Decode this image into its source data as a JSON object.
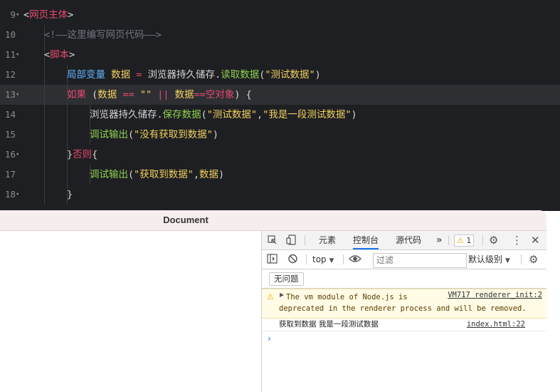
{
  "editor": {
    "lines": [
      {
        "num": "9",
        "fold": true,
        "tokens": [
          {
            "c": "br",
            "t": "<"
          },
          {
            "c": "tag",
            "t": "网页主体"
          },
          {
            "c": "br",
            "t": ">"
          }
        ]
      },
      {
        "num": "10",
        "fold": false,
        "indent": 1,
        "tokens": [
          {
            "c": "cm",
            "t": "<!——这里编写网页代码——>"
          }
        ]
      },
      {
        "num": "11",
        "fold": true,
        "indent": 1,
        "tokens": [
          {
            "c": "br",
            "t": "<"
          },
          {
            "c": "tag",
            "t": "脚本"
          },
          {
            "c": "br",
            "t": ">"
          }
        ]
      },
      {
        "num": "12",
        "fold": false,
        "indent": 2,
        "tokens": [
          {
            "c": "bl",
            "t": "局部变量"
          },
          {
            "c": "pl",
            "t": " "
          },
          {
            "c": "var",
            "t": "数据"
          },
          {
            "c": "pl",
            "t": " "
          },
          {
            "c": "op",
            "t": "="
          },
          {
            "c": "pl",
            "t": " "
          },
          {
            "c": "obj",
            "t": "浏览器持久储存"
          },
          {
            "c": "pl",
            "t": "."
          },
          {
            "c": "mth",
            "t": "读取数据"
          },
          {
            "c": "pl",
            "t": "("
          },
          {
            "c": "str",
            "t": "\"测试数据\""
          },
          {
            "c": "pl",
            "t": ")"
          }
        ]
      },
      {
        "num": "13",
        "fold": true,
        "indent": 2,
        "active": true,
        "tokens": [
          {
            "c": "kw",
            "t": "如果"
          },
          {
            "c": "pl",
            "t": " ("
          },
          {
            "c": "var",
            "t": "数据"
          },
          {
            "c": "pl",
            "t": " "
          },
          {
            "c": "op",
            "t": "=="
          },
          {
            "c": "pl",
            "t": " "
          },
          {
            "c": "str",
            "t": "\"\""
          },
          {
            "c": "pl",
            "t": " "
          },
          {
            "c": "op",
            "t": "||"
          },
          {
            "c": "pl",
            "t": " "
          },
          {
            "c": "var",
            "t": "数据"
          },
          {
            "c": "op",
            "t": "=="
          },
          {
            "c": "kw",
            "t": "空对象"
          },
          {
            "c": "pl",
            "t": ") {"
          }
        ]
      },
      {
        "num": "14",
        "fold": false,
        "indent": 3,
        "tokens": [
          {
            "c": "obj",
            "t": "浏览器持久储存"
          },
          {
            "c": "pl",
            "t": "."
          },
          {
            "c": "mth",
            "t": "保存数据"
          },
          {
            "c": "pl",
            "t": "("
          },
          {
            "c": "str",
            "t": "\"测试数据\""
          },
          {
            "c": "pl",
            "t": ","
          },
          {
            "c": "str",
            "t": "\"我是一段测试数据\""
          },
          {
            "c": "pl",
            "t": ")"
          }
        ]
      },
      {
        "num": "15",
        "fold": false,
        "indent": 3,
        "tokens": [
          {
            "c": "fn",
            "t": "调试输出"
          },
          {
            "c": "pl",
            "t": "("
          },
          {
            "c": "str",
            "t": "\"没有获取到数据\""
          },
          {
            "c": "pl",
            "t": ")"
          }
        ]
      },
      {
        "num": "16",
        "fold": true,
        "indent": 2,
        "tokens": [
          {
            "c": "pl",
            "t": "}"
          },
          {
            "c": "kw",
            "t": "否则"
          },
          {
            "c": "pl",
            "t": "{"
          }
        ]
      },
      {
        "num": "17",
        "fold": false,
        "indent": 3,
        "tokens": [
          {
            "c": "fn",
            "t": "调试输出"
          },
          {
            "c": "pl",
            "t": "("
          },
          {
            "c": "str",
            "t": "\"获取到数据\""
          },
          {
            "c": "pl",
            "t": ","
          },
          {
            "c": "var",
            "t": "数据"
          },
          {
            "c": "pl",
            "t": ")"
          }
        ]
      },
      {
        "num": "18",
        "fold": true,
        "indent": 2,
        "tokens": [
          {
            "c": "pl",
            "t": "}"
          }
        ]
      }
    ]
  },
  "window": {
    "title": "Document"
  },
  "devtools": {
    "tabs": {
      "elements": "元素",
      "console": "控制台",
      "sources": "源代码",
      "more": "»"
    },
    "warning_badge": "1",
    "toolbar": {
      "context": "top",
      "filter_placeholder": "过滤",
      "levels": "默认级别"
    },
    "issues_button": "无问题",
    "messages": {
      "warning_text": "The vm module of Node.js is deprecated in the renderer process and will be removed.",
      "warning_source": "VM717 renderer_init:2",
      "log_text": "获取到数据 我是一段测试数据",
      "log_source": "index.html:22"
    },
    "prompt_symbol": "›"
  },
  "colors": {
    "editor_bg": "#1e1f22",
    "accent": "#1a73e8",
    "warning_bg": "#fffbe5"
  }
}
